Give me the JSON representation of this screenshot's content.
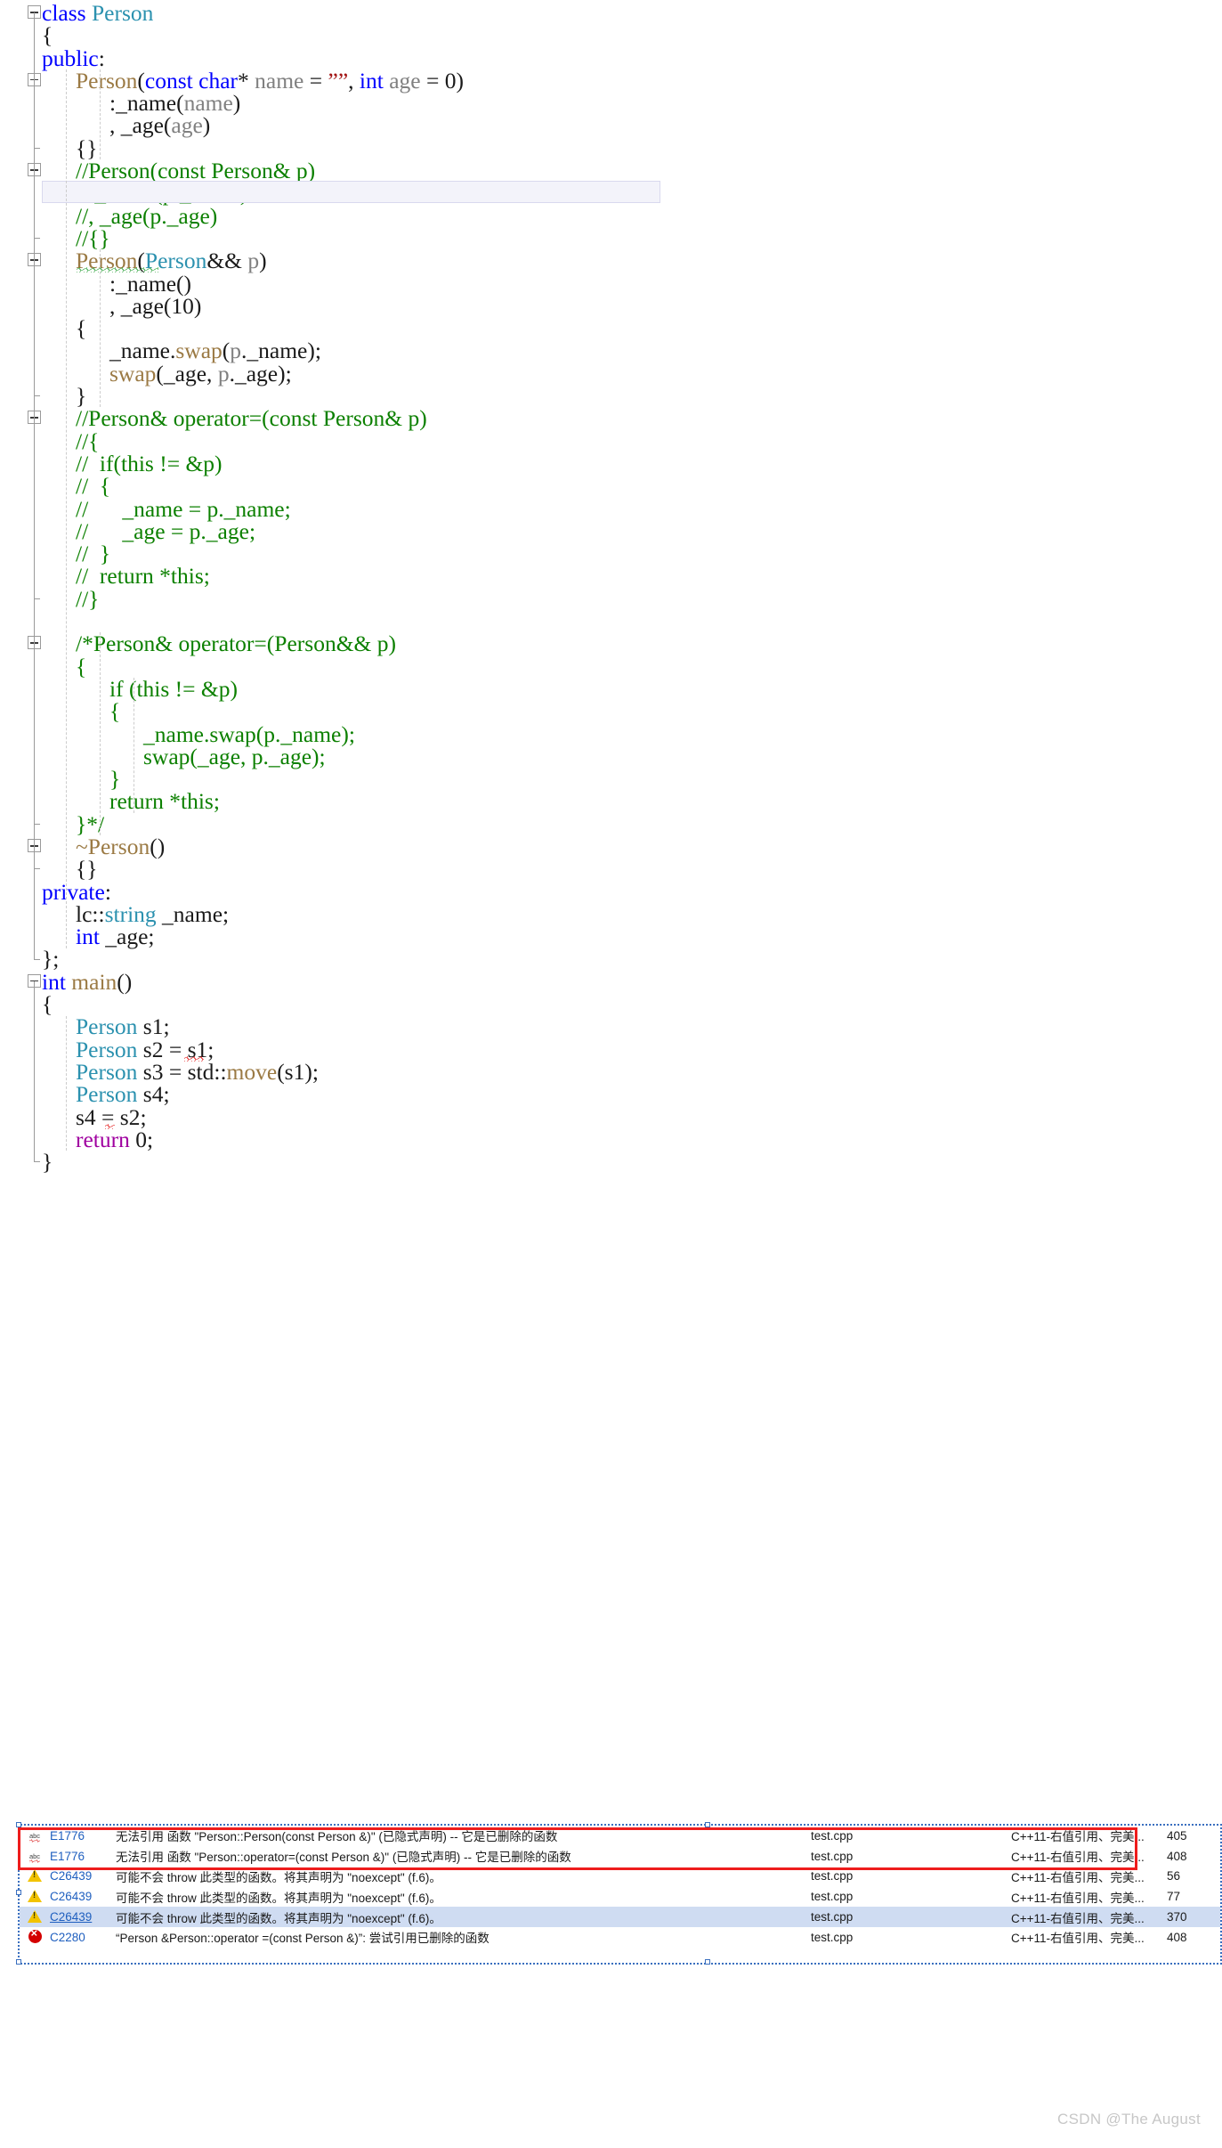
{
  "editor": {
    "language": "cpp",
    "current_line_index": 8,
    "colors": {
      "keyword": "#0000ff",
      "type": "#2b91af",
      "function": "#9b7a44",
      "comment": "#0c8000",
      "string": "#a31515",
      "parameter": "#808080",
      "return_keyword": "#a000a0",
      "plain": "#1a1a1a",
      "current_line_bg": "#f3f3fa",
      "error_squiggle": "#e00000",
      "warning_squiggle": "#1a9a2a"
    },
    "lines": [
      {
        "n": 0,
        "fold": true,
        "indent": 0,
        "tokens": [
          {
            "t": "class ",
            "c": "kw"
          },
          {
            "t": "Person",
            "c": "type"
          }
        ]
      },
      {
        "n": 1,
        "fold": false,
        "indent": 0,
        "tokens": [
          {
            "t": "{",
            "c": "plain"
          }
        ]
      },
      {
        "n": 2,
        "fold": false,
        "indent": 0,
        "tokens": [
          {
            "t": "public",
            "c": "kw"
          },
          {
            "t": ":",
            "c": "plain"
          }
        ]
      },
      {
        "n": 3,
        "fold": true,
        "indent": 1,
        "tokens": [
          {
            "t": "Person",
            "c": "fn"
          },
          {
            "t": "(",
            "c": "plain"
          },
          {
            "t": "const ",
            "c": "kw"
          },
          {
            "t": "char",
            "c": "kw"
          },
          {
            "t": "* ",
            "c": "plain"
          },
          {
            "t": "name",
            "c": "param"
          },
          {
            "t": " = ",
            "c": "plain"
          },
          {
            "t": "””",
            "c": "str"
          },
          {
            "t": ", ",
            "c": "plain"
          },
          {
            "t": "int ",
            "c": "kw"
          },
          {
            "t": "age",
            "c": "param"
          },
          {
            "t": " = ",
            "c": "plain"
          },
          {
            "t": "0)",
            "c": "plain"
          }
        ]
      },
      {
        "n": 4,
        "fold": false,
        "indent": 2,
        "tokens": [
          {
            "t": ":_name",
            "c": "plain"
          },
          {
            "t": "(",
            "c": "plain"
          },
          {
            "t": "name",
            "c": "param"
          },
          {
            "t": ")",
            "c": "plain"
          }
        ]
      },
      {
        "n": 5,
        "fold": false,
        "indent": 2,
        "tokens": [
          {
            "t": ", _age",
            "c": "plain"
          },
          {
            "t": "(",
            "c": "plain"
          },
          {
            "t": "age",
            "c": "param"
          },
          {
            "t": ")",
            "c": "plain"
          }
        ]
      },
      {
        "n": 6,
        "fold": false,
        "indent": 1,
        "tokens": [
          {
            "t": "{}",
            "c": "plain"
          }
        ]
      },
      {
        "n": 7,
        "fold": true,
        "indent": 1,
        "tokens": [
          {
            "t": "//Person(const Person& p)",
            "c": "cmt"
          }
        ]
      },
      {
        "n": 8,
        "fold": false,
        "indent": 1,
        "tokens": [
          {
            "t": "//:_name(p._name)",
            "c": "cmt"
          }
        ]
      },
      {
        "n": 9,
        "fold": false,
        "indent": 1,
        "tokens": [
          {
            "t": "//, _age(p._age)",
            "c": "cmt"
          }
        ]
      },
      {
        "n": 10,
        "fold": false,
        "indent": 1,
        "tokens": [
          {
            "t": "//{}",
            "c": "cmt"
          }
        ]
      },
      {
        "n": 11,
        "fold": true,
        "indent": 1,
        "tokens": [
          {
            "t": "Person",
            "c": "fn"
          },
          {
            "t": "(",
            "c": "plain"
          },
          {
            "t": "Person",
            "c": "type"
          },
          {
            "t": "&& ",
            "c": "plain"
          },
          {
            "t": "p",
            "c": "param"
          },
          {
            "t": ")",
            "c": "plain"
          }
        ]
      },
      {
        "n": 12,
        "fold": false,
        "indent": 2,
        "tokens": [
          {
            "t": ":_name()",
            "c": "plain"
          }
        ]
      },
      {
        "n": 13,
        "fold": false,
        "indent": 2,
        "tokens": [
          {
            "t": ", _age(10)",
            "c": "plain"
          }
        ]
      },
      {
        "n": 14,
        "fold": false,
        "indent": 1,
        "tokens": [
          {
            "t": "{",
            "c": "plain"
          }
        ]
      },
      {
        "n": 15,
        "fold": false,
        "indent": 2,
        "tokens": [
          {
            "t": "_name.",
            "c": "plain"
          },
          {
            "t": "swap",
            "c": "fn"
          },
          {
            "t": "(",
            "c": "plain"
          },
          {
            "t": "p",
            "c": "param"
          },
          {
            "t": "._name);",
            "c": "plain"
          }
        ]
      },
      {
        "n": 16,
        "fold": false,
        "indent": 2,
        "tokens": [
          {
            "t": "swap",
            "c": "fn"
          },
          {
            "t": "(_age, ",
            "c": "plain"
          },
          {
            "t": "p",
            "c": "param"
          },
          {
            "t": "._age);",
            "c": "plain"
          }
        ]
      },
      {
        "n": 17,
        "fold": false,
        "indent": 1,
        "tokens": [
          {
            "t": "}",
            "c": "plain"
          }
        ]
      },
      {
        "n": 18,
        "fold": true,
        "indent": 1,
        "tokens": [
          {
            "t": "//Person& operator=(const Person& p)",
            "c": "cmt"
          }
        ]
      },
      {
        "n": 19,
        "fold": false,
        "indent": 1,
        "tokens": [
          {
            "t": "//{",
            "c": "cmt"
          }
        ]
      },
      {
        "n": 20,
        "fold": false,
        "indent": 1,
        "tokens": [
          {
            "t": "//  if(this != &p)",
            "c": "cmt"
          }
        ]
      },
      {
        "n": 21,
        "fold": false,
        "indent": 1,
        "tokens": [
          {
            "t": "//  {",
            "c": "cmt"
          }
        ]
      },
      {
        "n": 22,
        "fold": false,
        "indent": 1,
        "tokens": [
          {
            "t": "//      _name = p._name;",
            "c": "cmt"
          }
        ]
      },
      {
        "n": 23,
        "fold": false,
        "indent": 1,
        "tokens": [
          {
            "t": "//      _age = p._age;",
            "c": "cmt"
          }
        ]
      },
      {
        "n": 24,
        "fold": false,
        "indent": 1,
        "tokens": [
          {
            "t": "//  }",
            "c": "cmt"
          }
        ]
      },
      {
        "n": 25,
        "fold": false,
        "indent": 1,
        "tokens": [
          {
            "t": "//  return *this;",
            "c": "cmt"
          }
        ]
      },
      {
        "n": 26,
        "fold": false,
        "indent": 1,
        "tokens": [
          {
            "t": "//}",
            "c": "cmt"
          }
        ]
      },
      {
        "n": 27,
        "fold": false,
        "indent": 1,
        "tokens": [
          {
            "t": "",
            "c": "plain"
          }
        ]
      },
      {
        "n": 28,
        "fold": true,
        "indent": 1,
        "tokens": [
          {
            "t": "/*Person& operator=(Person&& p)",
            "c": "cmt"
          }
        ]
      },
      {
        "n": 29,
        "fold": false,
        "indent": 1,
        "tokens": [
          {
            "t": "{",
            "c": "cmt"
          }
        ]
      },
      {
        "n": 30,
        "fold": false,
        "indent": 2,
        "tokens": [
          {
            "t": "if (this != &p)",
            "c": "cmt"
          }
        ]
      },
      {
        "n": 31,
        "fold": false,
        "indent": 2,
        "tokens": [
          {
            "t": "{",
            "c": "cmt"
          }
        ]
      },
      {
        "n": 32,
        "fold": false,
        "indent": 3,
        "tokens": [
          {
            "t": "_name.swap(p._name);",
            "c": "cmt"
          }
        ]
      },
      {
        "n": 33,
        "fold": false,
        "indent": 3,
        "tokens": [
          {
            "t": "swap(_age, p._age);",
            "c": "cmt"
          }
        ]
      },
      {
        "n": 34,
        "fold": false,
        "indent": 2,
        "tokens": [
          {
            "t": "}",
            "c": "cmt"
          }
        ]
      },
      {
        "n": 35,
        "fold": false,
        "indent": 2,
        "tokens": [
          {
            "t": "return *this;",
            "c": "cmt"
          }
        ]
      },
      {
        "n": 36,
        "fold": false,
        "indent": 1,
        "tokens": [
          {
            "t": "}*/",
            "c": "cmt"
          }
        ]
      },
      {
        "n": 37,
        "fold": true,
        "indent": 1,
        "tokens": [
          {
            "t": "~Person",
            "c": "fn"
          },
          {
            "t": "()",
            "c": "plain"
          }
        ]
      },
      {
        "n": 38,
        "fold": false,
        "indent": 1,
        "tokens": [
          {
            "t": "{}",
            "c": "plain"
          }
        ]
      },
      {
        "n": 39,
        "fold": false,
        "indent": 0,
        "tokens": [
          {
            "t": "private",
            "c": "kw"
          },
          {
            "t": ":",
            "c": "plain"
          }
        ]
      },
      {
        "n": 40,
        "fold": false,
        "indent": 1,
        "tokens": [
          {
            "t": "lc::",
            "c": "plain"
          },
          {
            "t": "string",
            "c": "type"
          },
          {
            "t": " _name;",
            "c": "plain"
          }
        ]
      },
      {
        "n": 41,
        "fold": false,
        "indent": 1,
        "tokens": [
          {
            "t": "int",
            "c": "kw"
          },
          {
            "t": " _age;",
            "c": "plain"
          }
        ]
      },
      {
        "n": 42,
        "fold": false,
        "indent": 0,
        "tokens": [
          {
            "t": "};",
            "c": "plain"
          }
        ]
      },
      {
        "n": 43,
        "fold": true,
        "indent": 0,
        "tokens": [
          {
            "t": "int ",
            "c": "kw"
          },
          {
            "t": "main",
            "c": "fn"
          },
          {
            "t": "()",
            "c": "plain"
          }
        ]
      },
      {
        "n": 44,
        "fold": false,
        "indent": 0,
        "tokens": [
          {
            "t": "{",
            "c": "plain"
          }
        ]
      },
      {
        "n": 45,
        "fold": false,
        "indent": 1,
        "tokens": [
          {
            "t": "Person",
            "c": "type"
          },
          {
            "t": " s1;",
            "c": "plain"
          }
        ]
      },
      {
        "n": 46,
        "fold": false,
        "indent": 1,
        "tokens": [
          {
            "t": "Person",
            "c": "type"
          },
          {
            "t": " s2 = s1;",
            "c": "plain"
          }
        ]
      },
      {
        "n": 47,
        "fold": false,
        "indent": 1,
        "tokens": [
          {
            "t": "Person",
            "c": "type"
          },
          {
            "t": " s3 = std::",
            "c": "plain"
          },
          {
            "t": "move",
            "c": "fn"
          },
          {
            "t": "(s1);",
            "c": "plain"
          }
        ]
      },
      {
        "n": 48,
        "fold": false,
        "indent": 1,
        "tokens": [
          {
            "t": "Person",
            "c": "type"
          },
          {
            "t": " s4;",
            "c": "plain"
          }
        ]
      },
      {
        "n": 49,
        "fold": false,
        "indent": 1,
        "tokens": [
          {
            "t": "s4 = s2;",
            "c": "plain"
          }
        ]
      },
      {
        "n": 50,
        "fold": false,
        "indent": 1,
        "tokens": [
          {
            "t": "return",
            "c": "ret"
          },
          {
            "t": " 0;",
            "c": "plain"
          }
        ]
      },
      {
        "n": 51,
        "fold": false,
        "indent": 0,
        "tokens": [
          {
            "t": "}",
            "c": "plain"
          }
        ]
      }
    ]
  },
  "error_list": {
    "columns": [
      "icon",
      "code",
      "description",
      "file",
      "project",
      "line"
    ],
    "rows": [
      {
        "severity": "message",
        "icon": "abc-squiggle-icon",
        "code": "E1776",
        "code_underlined": false,
        "description": "无法引用 函数 \"Person::Person(const Person &)\" (已隐式声明) -- 它是已删除的函数",
        "file": "test.cpp",
        "project": "C++11-右值引用、完美...",
        "line": "405",
        "selected": false
      },
      {
        "severity": "message",
        "icon": "abc-squiggle-icon",
        "code": "E1776",
        "code_underlined": false,
        "description": "无法引用 函数 \"Person::operator=(const Person &)\" (已隐式声明) -- 它是已删除的函数",
        "file": "test.cpp",
        "project": "C++11-右值引用、完美...",
        "line": "408",
        "selected": false
      },
      {
        "severity": "warning",
        "icon": "warning-triangle-icon",
        "code": "C26439",
        "code_underlined": false,
        "description": "可能不会 throw 此类型的函数。将其声明为 \"noexcept\" (f.6)。",
        "file": "test.cpp",
        "project": "C++11-右值引用、完美...",
        "line": "56",
        "selected": false
      },
      {
        "severity": "warning",
        "icon": "warning-triangle-icon",
        "code": "C26439",
        "code_underlined": false,
        "description": "可能不会 throw 此类型的函数。将其声明为 \"noexcept\" (f.6)。",
        "file": "test.cpp",
        "project": "C++11-右值引用、完美...",
        "line": "77",
        "selected": false
      },
      {
        "severity": "warning",
        "icon": "warning-triangle-icon",
        "code": "C26439",
        "code_underlined": true,
        "description": "可能不会 throw 此类型的函数。将其声明为 \"noexcept\" (f.6)。",
        "file": "test.cpp",
        "project": "C++11-右值引用、完美...",
        "line": "370",
        "selected": true
      },
      {
        "severity": "error",
        "icon": "error-circle-icon",
        "code": "C2280",
        "code_underlined": false,
        "description": "“Person &Person::operator =(const Person &)”: 尝试引用已删除的函数",
        "file": "test.cpp",
        "project": "C++11-右值引用、完美...",
        "line": "408",
        "selected": false
      }
    ],
    "annotation": {
      "shape": "red-rectangle",
      "accent": "#ee1c1c",
      "covers_rows": [
        0,
        1
      ]
    },
    "panel_border_color": "#3a6fbf"
  },
  "watermark": {
    "text": "CSDN @The  August"
  }
}
